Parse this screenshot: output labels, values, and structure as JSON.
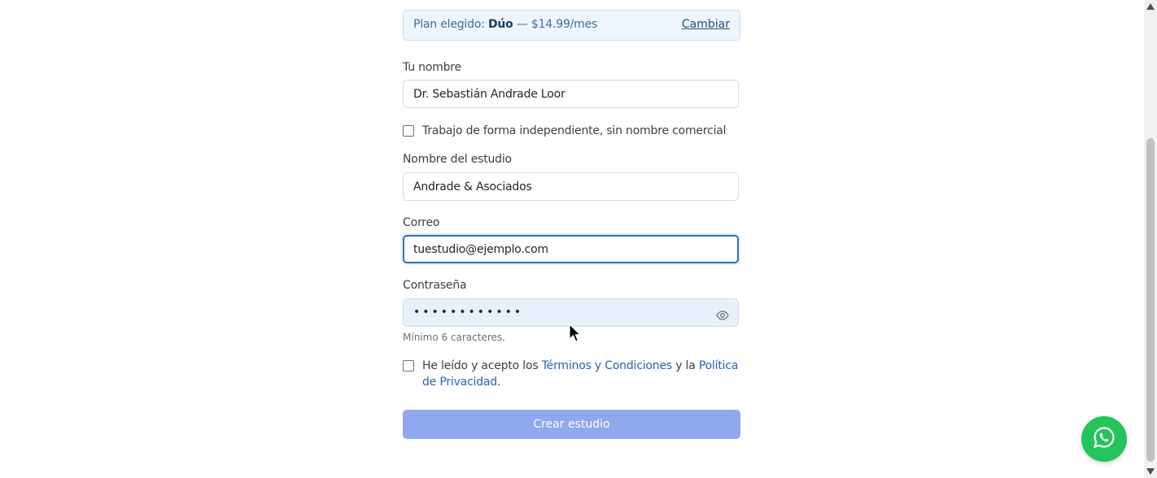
{
  "plan": {
    "prefix": "Plan elegido: ",
    "name": "Dúo",
    "price": " — $14.99/mes",
    "change_label": "Cambiar"
  },
  "form": {
    "name_label": "Tu nombre",
    "name_value": "Dr. Sebastián Andrade Loor",
    "independent_label": "Trabajo de forma independiente, sin nombre comercial",
    "studio_label": "Nombre del estudio",
    "studio_value": "Andrade & Asociados",
    "email_label": "Correo",
    "email_value": "tuestudio@ejemplo.com",
    "password_label": "Contraseña",
    "password_value": "••••••••••••",
    "password_hint": "Mínimo 6 caracteres.",
    "terms_prefix": "He leído y acepto los ",
    "terms_link": "Términos y Condiciones",
    "terms_mid": " y la ",
    "privacy_link": "Política de Privacidad",
    "terms_suffix": ".",
    "submit_label": "Crear estudio"
  },
  "icons": {
    "password_toggle": "eye-icon",
    "chat": "whatsapp-icon"
  },
  "colors": {
    "accent": "#2f6ec9",
    "submit_disabled": "#8fa8ee",
    "whatsapp": "#25c45a",
    "link": "#2563b8"
  }
}
